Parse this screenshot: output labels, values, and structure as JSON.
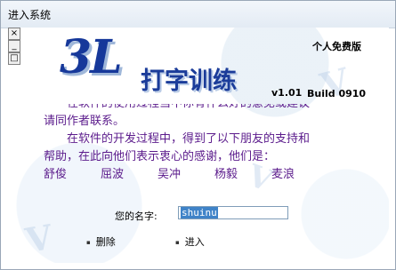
{
  "window": {
    "title": "进入系统"
  },
  "system_buttons": [
    {
      "icon": "close-icon",
      "glyph": "×"
    },
    {
      "icon": "minimize-icon",
      "glyph": "_"
    },
    {
      "icon": "maximize-icon",
      "glyph": "□"
    }
  ],
  "logo": {
    "mark": "3L",
    "subtitle": "打字训练"
  },
  "free_label": "个人免费版",
  "version": "v1.01",
  "build": "Build 0910",
  "credits": {
    "lines": [
      "　　在软件的使用过程当中你有什么好的意见或建议",
      "请同作者联系。",
      "　　在软件的开发过程中，得到了以下朋友的支持和",
      "帮助，在此向他们表示衷心的感谢，他们是："
    ],
    "names": [
      "舒俊",
      "屈波",
      "吴冲",
      "杨毅",
      "麦浪"
    ]
  },
  "form": {
    "name_label": "您的名字:",
    "name_value": "shuinu"
  },
  "buttons": {
    "delete_label": "删除",
    "enter_label": "进入"
  }
}
